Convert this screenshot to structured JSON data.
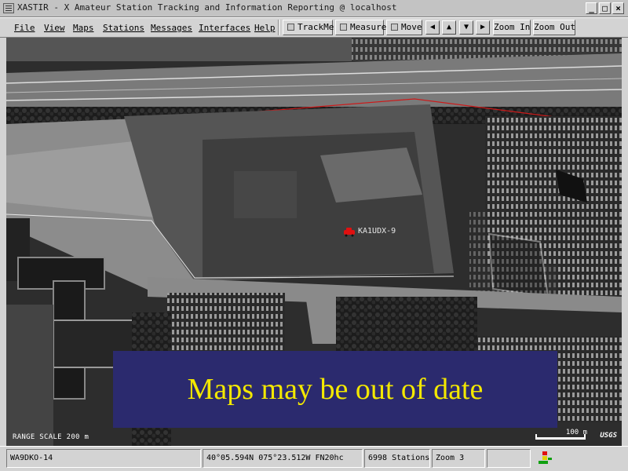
{
  "window": {
    "title": "XASTIR  - X Amateur Station Tracking and Information Reporting @ localhost",
    "controls": [
      "_",
      "□",
      "×"
    ]
  },
  "menubar": {
    "menus": [
      "File",
      "View",
      "Maps",
      "Stations",
      "Messages",
      "Interfaces",
      "Help"
    ],
    "toggles": [
      "TrackMe",
      "Measure",
      "Move"
    ],
    "pan_arrows": [
      "◀",
      "▲",
      "▼",
      "▶"
    ],
    "zoom_in": "Zoom In",
    "zoom_out": "Zoom Out"
  },
  "map": {
    "range_scale": "RANGE SCALE 200 m",
    "station_callsign": "KA1UDX-9",
    "banner_text": "Maps may be out of date",
    "scale_bar_label": "100 m",
    "logo_text": "USGS"
  },
  "statusbar": {
    "callsign": "WA9DKO-14",
    "position": "40°05.594N  075°23.512W  FN20hc",
    "station_count": "6998 Stations",
    "zoom": "Zoom 3",
    "empty": ""
  },
  "colors": {
    "banner_bg": "#2b2a6e",
    "banner_text": "#f3e800",
    "track_line": "#cc1a1a",
    "boundary_line": "#e6e6e6"
  }
}
